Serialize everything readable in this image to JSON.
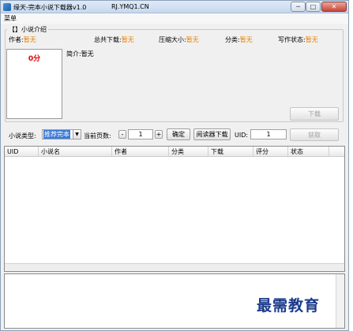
{
  "window": {
    "title": "缘天-完本小说下载器v1.0",
    "url_text": "RJ.YMQ1.CN",
    "min_symbol": "─",
    "max_symbol": "□",
    "close_symbol": "✕"
  },
  "menu": {
    "items": [
      {
        "label": "菜单"
      }
    ]
  },
  "intro": {
    "legend": "【】小说介绍",
    "author_label": "作者:",
    "author_value": "暂无",
    "total_downloads_label": "总共下载:",
    "total_downloads_value": "暂无",
    "compressed_size_label": "压缩大小:",
    "compressed_size_value": "暂无",
    "category_label": "分类:",
    "category_value": "暂无",
    "status_label": "写作状态:",
    "status_value": "暂无",
    "summary_label": "简介:",
    "summary_value": "暂无",
    "score": "0分",
    "download_button": "下载"
  },
  "toolbar": {
    "type_label": "小说类型:",
    "type_selected": "推荐完本",
    "dropdown_arrow": "▼",
    "page_label": "当前页数:",
    "page_minus": "-",
    "page_value": "1",
    "page_plus": "+",
    "confirm_button": "确定",
    "reader_download_button": "阅读器下载",
    "uid_label": "UID:",
    "uid_value": "1",
    "fetch_button": "获取"
  },
  "table": {
    "columns": [
      "UID",
      "小说名",
      "作者",
      "分类",
      "下载",
      "评分",
      "状态"
    ],
    "rows": []
  },
  "watermark": "最需教育"
}
